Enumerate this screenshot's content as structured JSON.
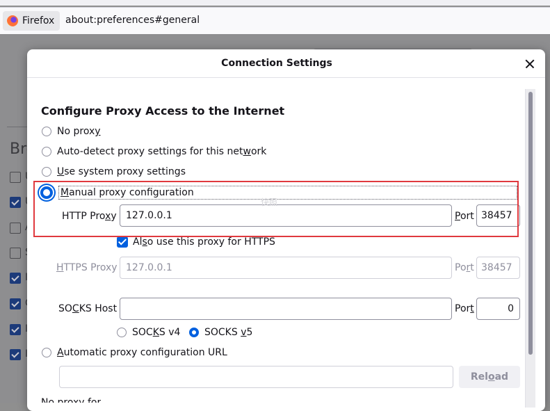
{
  "browser": {
    "identity_label": "Firefox",
    "url": "about:preferences#general"
  },
  "background_page": {
    "heading_fragment": "Bro",
    "row_letters": [
      "U",
      "U",
      "A",
      "S",
      "I",
      "C",
      "I",
      "I"
    ],
    "row_checked": [
      false,
      true,
      false,
      false,
      true,
      true,
      true,
      true
    ]
  },
  "dialog": {
    "title": "Connection Settings",
    "section_title": "Configure Proxy Access to the Internet",
    "proxy_options": {
      "no_proxy": {
        "pre": "No prox",
        "key": "y",
        "post": ""
      },
      "auto_detect": {
        "pre": "Auto-detect proxy settings for this net",
        "key": "w",
        "post": "ork"
      },
      "system": {
        "pre": "",
        "key": "U",
        "post": "se system proxy settings"
      },
      "manual": {
        "pre": "",
        "key": "M",
        "post": "anual proxy configuration"
      },
      "auto_url": {
        "pre": "",
        "key": "A",
        "post": "utomatic proxy configuration URL"
      }
    },
    "selected_option": "manual",
    "http_proxy": {
      "label_pre": "HTTP Pro",
      "label_key": "x",
      "label_post": "y",
      "value": "127.0.0.1",
      "port_label_key": "P",
      "port_label_post": "ort",
      "port": "38457"
    },
    "also_https": {
      "pre": "Al",
      "key": "s",
      "post": "o use this proxy for HTTPS",
      "checked": true
    },
    "https_proxy": {
      "label_key": "H",
      "label_post": "TTPS Proxy",
      "value": "127.0.0.1",
      "port_label_pre": "Po",
      "port_label_key": "r",
      "port_label_post": "t",
      "port": "38457"
    },
    "socks": {
      "label_pre": "SO",
      "label_key": "C",
      "label_post": "KS Host",
      "value": "",
      "port_label_pre": "Por",
      "port_label_key": "t",
      "port_label_post": "",
      "port": "0"
    },
    "socks_v4": {
      "pre": "SOC",
      "key": "K",
      "post": "S v4"
    },
    "socks_v5": {
      "pre": "SOCKS ",
      "key": "v",
      "post": "5",
      "selected": true
    },
    "auto_url_value": "",
    "reload": {
      "pre": "Rel",
      "key": "o",
      "post": "ad"
    },
    "partial_next": "No proxy for"
  },
  "watermark": "快照",
  "colors": {
    "accent": "#0060df",
    "highlight": "#e0393e"
  }
}
